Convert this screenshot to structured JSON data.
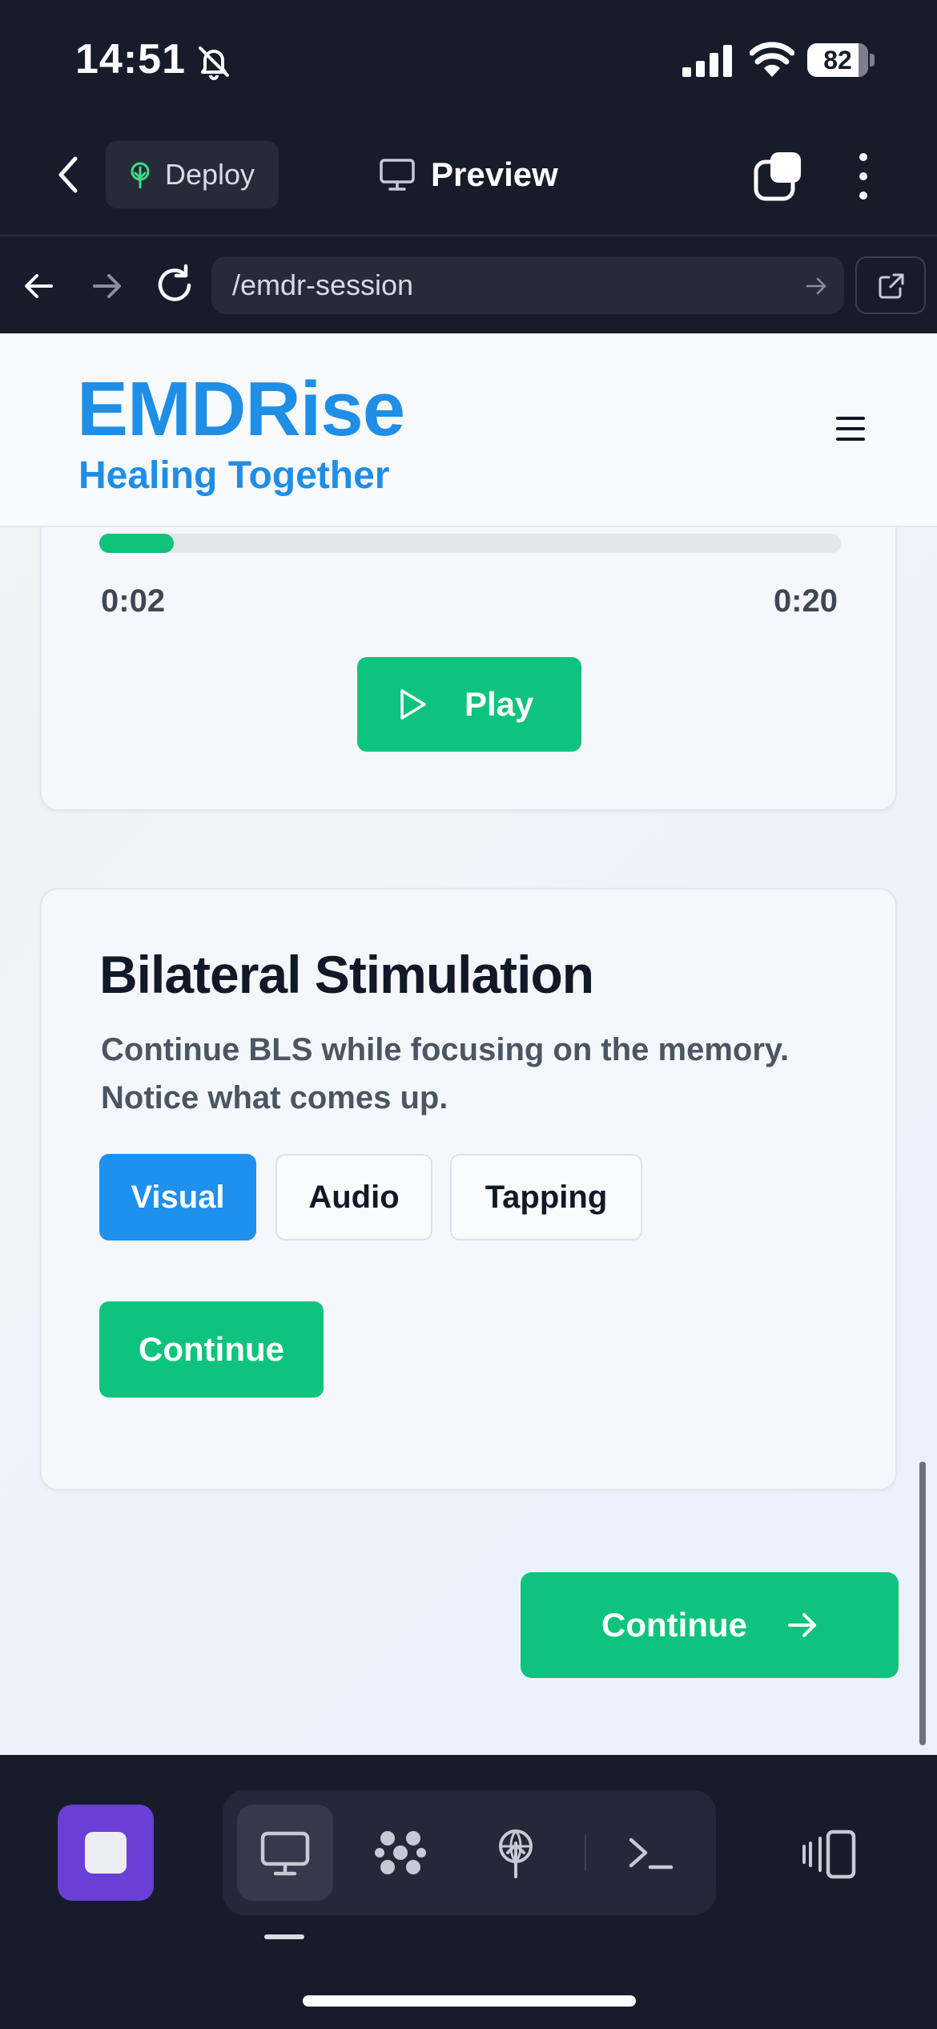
{
  "status_bar": {
    "time": "14:51",
    "battery": "82",
    "icons": [
      "bell-slash-icon",
      "cellular-signal-icon",
      "wifi-icon",
      "battery-icon"
    ]
  },
  "toolbar": {
    "deploy_label": "Deploy",
    "preview_label": "Preview",
    "icons": [
      "chevron-left-icon",
      "deploy-tree-icon",
      "monitor-icon",
      "tabs-icon",
      "more-vertical-icon"
    ]
  },
  "browser": {
    "url": "/emdr-session"
  },
  "site": {
    "brand": "EMDRise",
    "tagline": "Healing Together"
  },
  "audio_card": {
    "current_time": "0:02",
    "total_time": "0:20",
    "progress": 0.1,
    "play_label": "Play"
  },
  "bls_card": {
    "title": "Bilateral Stimulation",
    "description": "Continue BLS while focusing on the memory. Notice what comes up.",
    "modes": [
      {
        "label": "Visual",
        "selected": true
      },
      {
        "label": "Audio",
        "selected": false
      },
      {
        "label": "Tapping",
        "selected": false
      }
    ],
    "continue_label": "Continue"
  },
  "main_continue_label": "Continue",
  "colors": {
    "brand_blue": "#1e8ee6",
    "accent_green": "#0ec47c",
    "selected_blue": "#1e90ee",
    "dark_chrome": "#181c2a",
    "stop_purple": "#6a3fd8"
  },
  "dock": {
    "items": [
      "monitor-icon",
      "molecule-icon",
      "deploy-tree-icon",
      "terminal-icon"
    ],
    "active_index": 0
  }
}
